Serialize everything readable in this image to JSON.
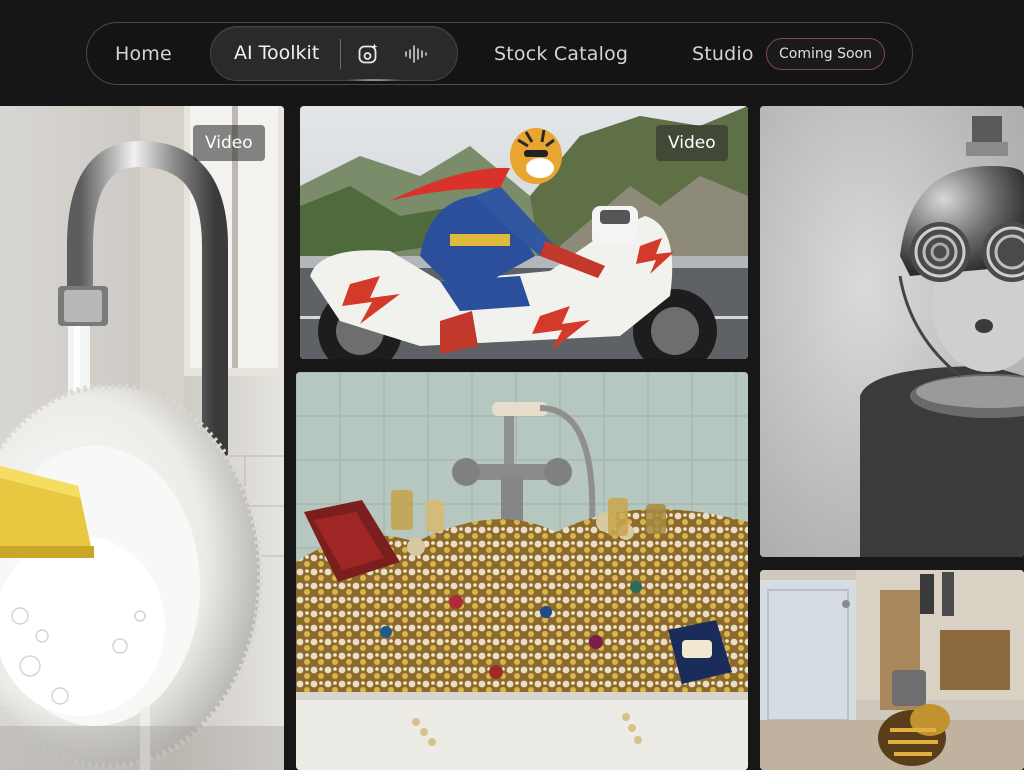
{
  "nav": {
    "home": "Home",
    "ai_toolkit": "AI Toolkit",
    "stock_catalog": "Stock Catalog",
    "studio": "Studio",
    "coming_soon": "Coming Soon",
    "toolkit_icons": [
      "sparkle-image-icon",
      "audio-wave-icon"
    ]
  },
  "gallery": [
    {
      "tag": "Video",
      "alt": "faucet-pouring-into-sink"
    },
    {
      "tag": "Video",
      "alt": "tiger-masked-hero-on-motorcycle"
    },
    {
      "tag": "",
      "alt": "bathtub-full-of-jewelry"
    },
    {
      "tag": "",
      "alt": "child-in-retro-helmet-goggles"
    },
    {
      "tag": "",
      "alt": "room-with-bee"
    }
  ],
  "colors": {
    "background": "#171717",
    "nav_border": "#4a4a4a",
    "pill_bg": "#2a2a2a",
    "badge_border": "#7a4a4a"
  }
}
